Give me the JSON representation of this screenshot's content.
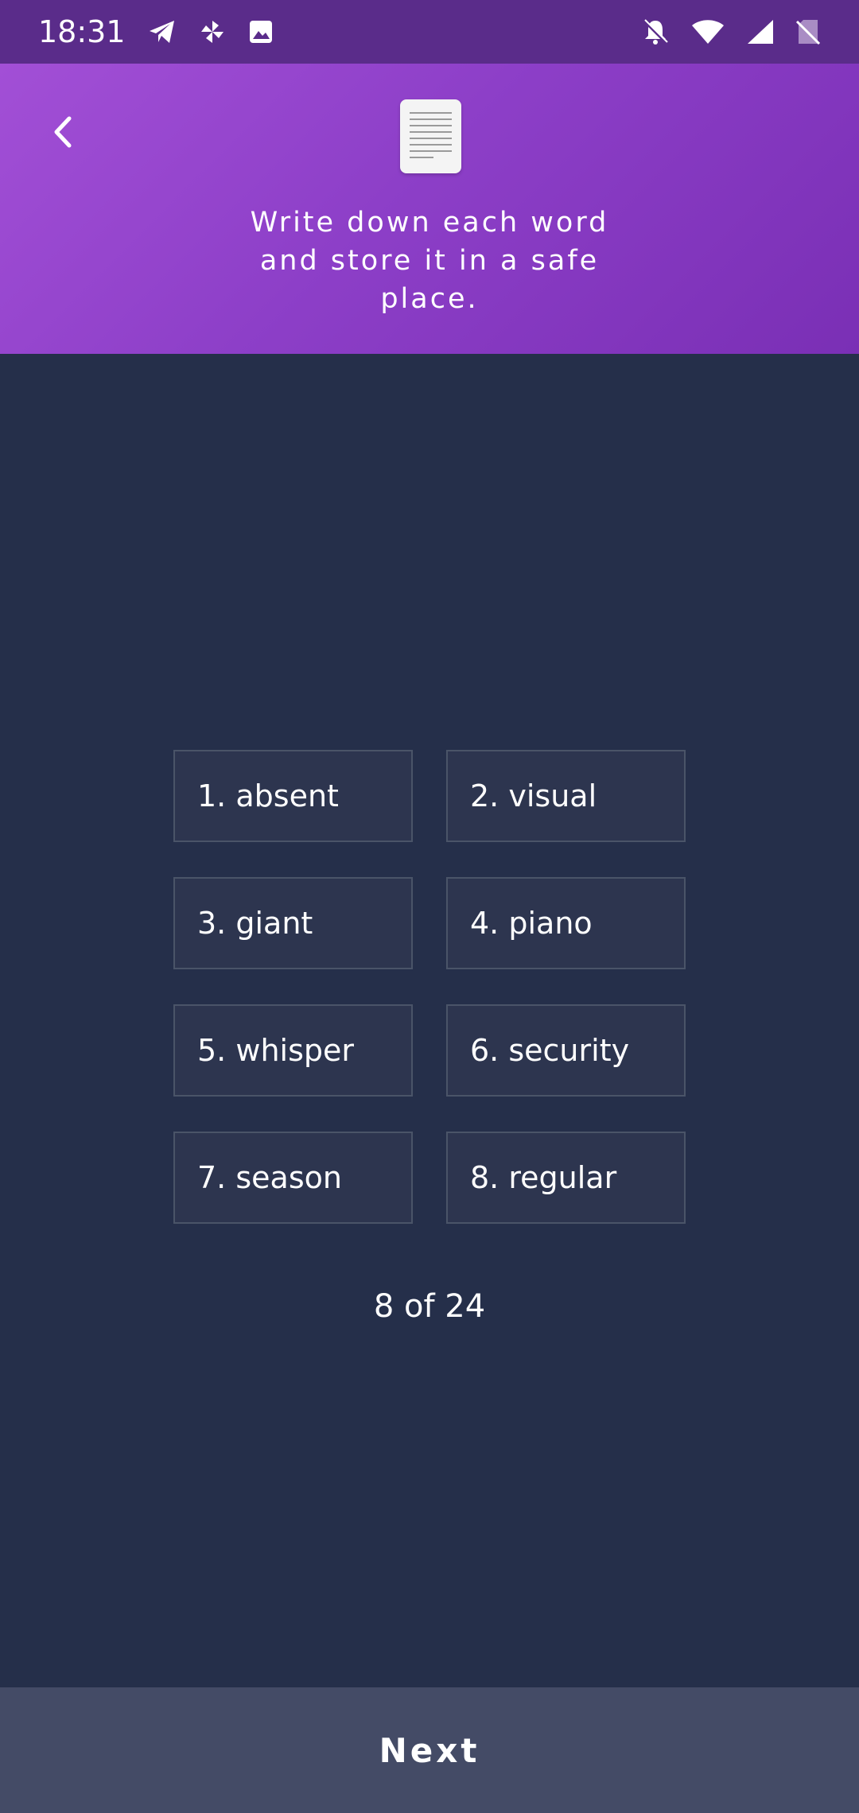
{
  "status_bar": {
    "time": "18:31",
    "left_icons": [
      "telegram-icon",
      "pinwheel-icon",
      "gallery-icon"
    ],
    "right_icons": [
      "notifications-off-icon",
      "wifi-icon",
      "signal-icon",
      "no-sim-icon"
    ]
  },
  "header": {
    "back_icon": "chevron-left-icon",
    "illustration": "document-icon",
    "instruction": "Write down each word and store it in a safe place."
  },
  "words": [
    {
      "number": "1.",
      "word": "absent"
    },
    {
      "number": "2.",
      "word": "visual"
    },
    {
      "number": "3.",
      "word": "giant"
    },
    {
      "number": "4.",
      "word": "piano"
    },
    {
      "number": "5.",
      "word": "whisper"
    },
    {
      "number": "6.",
      "word": "security"
    },
    {
      "number": "7.",
      "word": "season"
    },
    {
      "number": "8.",
      "word": "regular"
    }
  ],
  "progress": {
    "text": "8 of 24"
  },
  "footer": {
    "next_label": "Next"
  },
  "colors": {
    "background": "#252f4a",
    "header_gradient_start": "#a24fd6",
    "header_gradient_end": "#7a2fb5",
    "status_bar": "#5a2c8a",
    "word_box_border": "#4a5468",
    "next_button": "#444b66"
  }
}
